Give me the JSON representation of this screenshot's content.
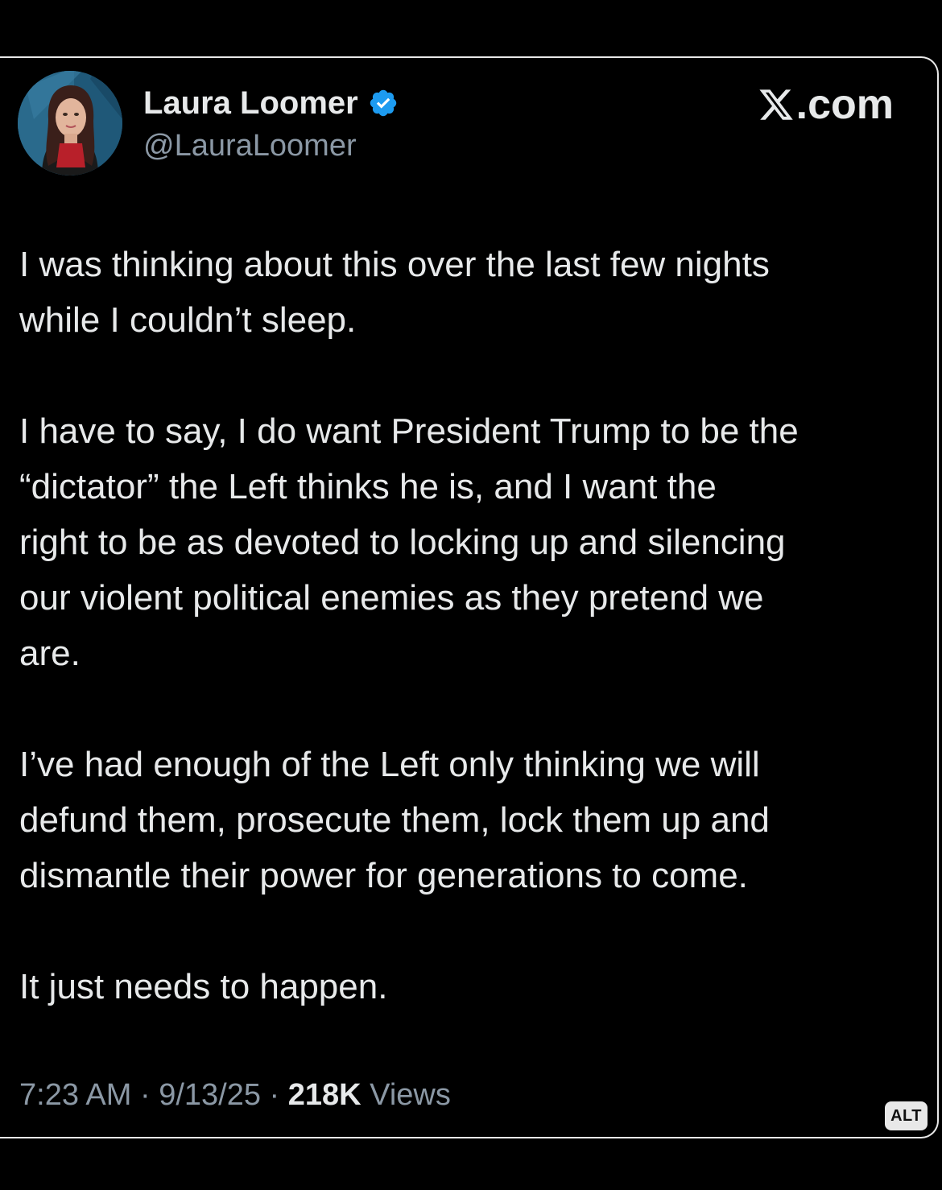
{
  "site": {
    "label": ".com",
    "logo_icon": "x-logo-icon"
  },
  "author": {
    "name": "Laura Loomer",
    "handle": "@LauraLoomer",
    "verified": true,
    "verified_color": "#1d9bf0"
  },
  "tweet": {
    "paragraphs": [
      "I was thinking about this over the last few nights\nwhile I couldn’t sleep.",
      "I have to say, I do want President Trump to be the\n“dictator” the Left thinks he is, and I want the\nright to be as devoted to locking up and silencing\nour violent political enemies as they pretend we\nare.",
      "I’ve had enough of the Left only thinking we will\ndefund them, prosecute them, lock them up and\ndismantle their power for generations to come.",
      "It just needs to happen."
    ]
  },
  "meta": {
    "time": "7:23 AM",
    "separator": " · ",
    "date": "9/13/25",
    "views_count": "218K",
    "views_label": " Views"
  },
  "alt_badge": "ALT",
  "colors": {
    "background": "#000000",
    "text": "#e7e9ea",
    "muted": "#8b98a5"
  }
}
